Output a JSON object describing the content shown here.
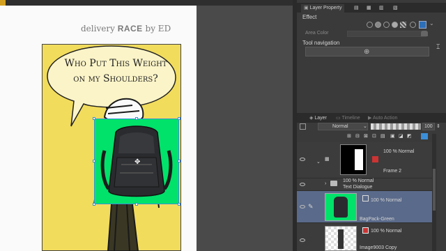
{
  "canvas": {
    "brand_prefix": "delivery",
    "brand_main": "RACE",
    "brand_suffix": "by ED",
    "speech_bubble": "Who Put This Weight on my Shoulders?"
  },
  "panel": {
    "layer_property_tab": "Layer Property",
    "effect_label": "Effect",
    "area_color_label": "Area Color",
    "tool_navigation_label": "Tool navigation",
    "layer_tab": "Layer",
    "timeline_tab": "Timeline",
    "auto_action_tab": "Auto Action",
    "blend_mode": "Normal",
    "opacity": "100"
  },
  "layers": [
    {
      "opacity_mode": "100 % Normal",
      "name": "Frame 2"
    },
    {
      "opacity_mode": "100 % Normal",
      "name": "Text Dialogue"
    },
    {
      "opacity_mode": "100 % Normal",
      "name": "BagPack-Green"
    },
    {
      "opacity_mode": "100 % Normal",
      "name": "Image9003 Copy"
    }
  ],
  "colors": {
    "comic_bg": "#f2dc5c",
    "green_screen": "#00e26a",
    "selected_layer": "#5a6a8a",
    "accent_blue": "#3b8fd8"
  }
}
